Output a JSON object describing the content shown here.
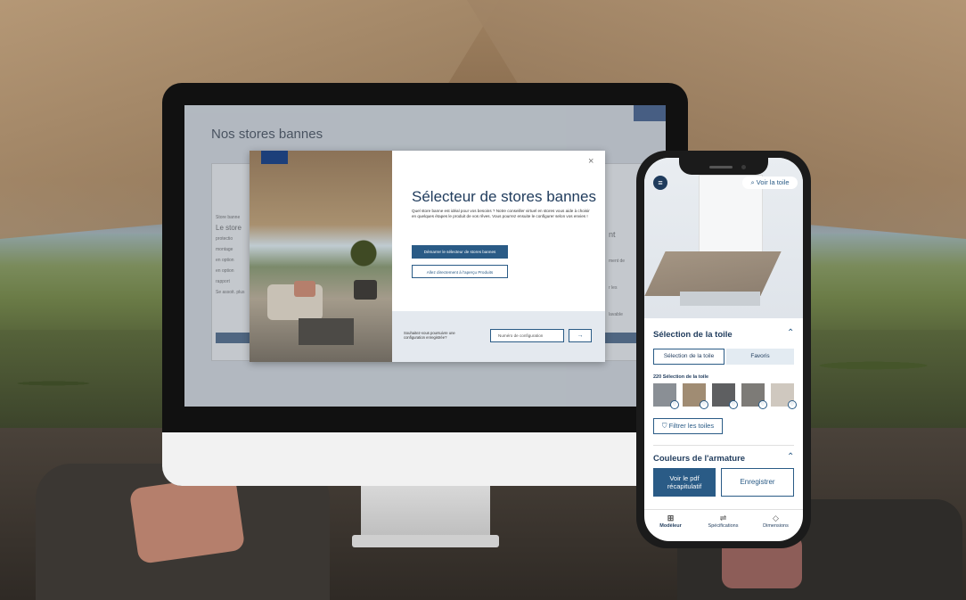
{
  "desktop": {
    "site_title": "Nos stores bannes",
    "site_left_text": [
      "Store banne",
      "Le store",
      "protectio",
      "montage",
      "en option",
      "en option",
      "rapport",
      "Se assoit. plus"
    ],
    "site_right_text": [
      "nt",
      "ment de",
      "r les",
      "lavable"
    ],
    "modal": {
      "title": "Sélecteur de stores bannes",
      "description": "Quel store banne est idéal pour vos besoins ? Notre conseiller virtuel en stores vous aide à choisir en quelques étapes le produit de vos rêves. Vous pourrez ensuite le configurer selon vos envies !",
      "primary_button": "Démarrer le sélecteur de stores bannes",
      "secondary_button": "Allez directement à l'aperçu Produits",
      "footer_question": "Souhaitez-vous poursuivre une configuration enregistrée?",
      "config_placeholder": "Numéro de configuration",
      "go_arrow": "→",
      "close": "×"
    }
  },
  "mobile": {
    "view_fabric": "Voir la toile",
    "section_fabric": "Sélection de la toile",
    "tabs": [
      "Sélection de la toile",
      "Favoris"
    ],
    "fabric_count": "220 Sélection de la toile",
    "swatch_colors": [
      "#8a8f95",
      "#a08c73",
      "#5e5f61",
      "#7d7b77",
      "#cfc8bf"
    ],
    "filter_button": "Filtrer les toiles",
    "section_frame": "Couleurs de l'armature",
    "pdf_button": "Voir le pdf récapitulatif",
    "save_button": "Enregistrer",
    "nav": [
      {
        "label": "Modèleur",
        "icon": "model-icon"
      },
      {
        "label": "Spécifications",
        "icon": "sliders-icon"
      },
      {
        "label": "Dimensions",
        "icon": "ruler-icon"
      }
    ]
  }
}
